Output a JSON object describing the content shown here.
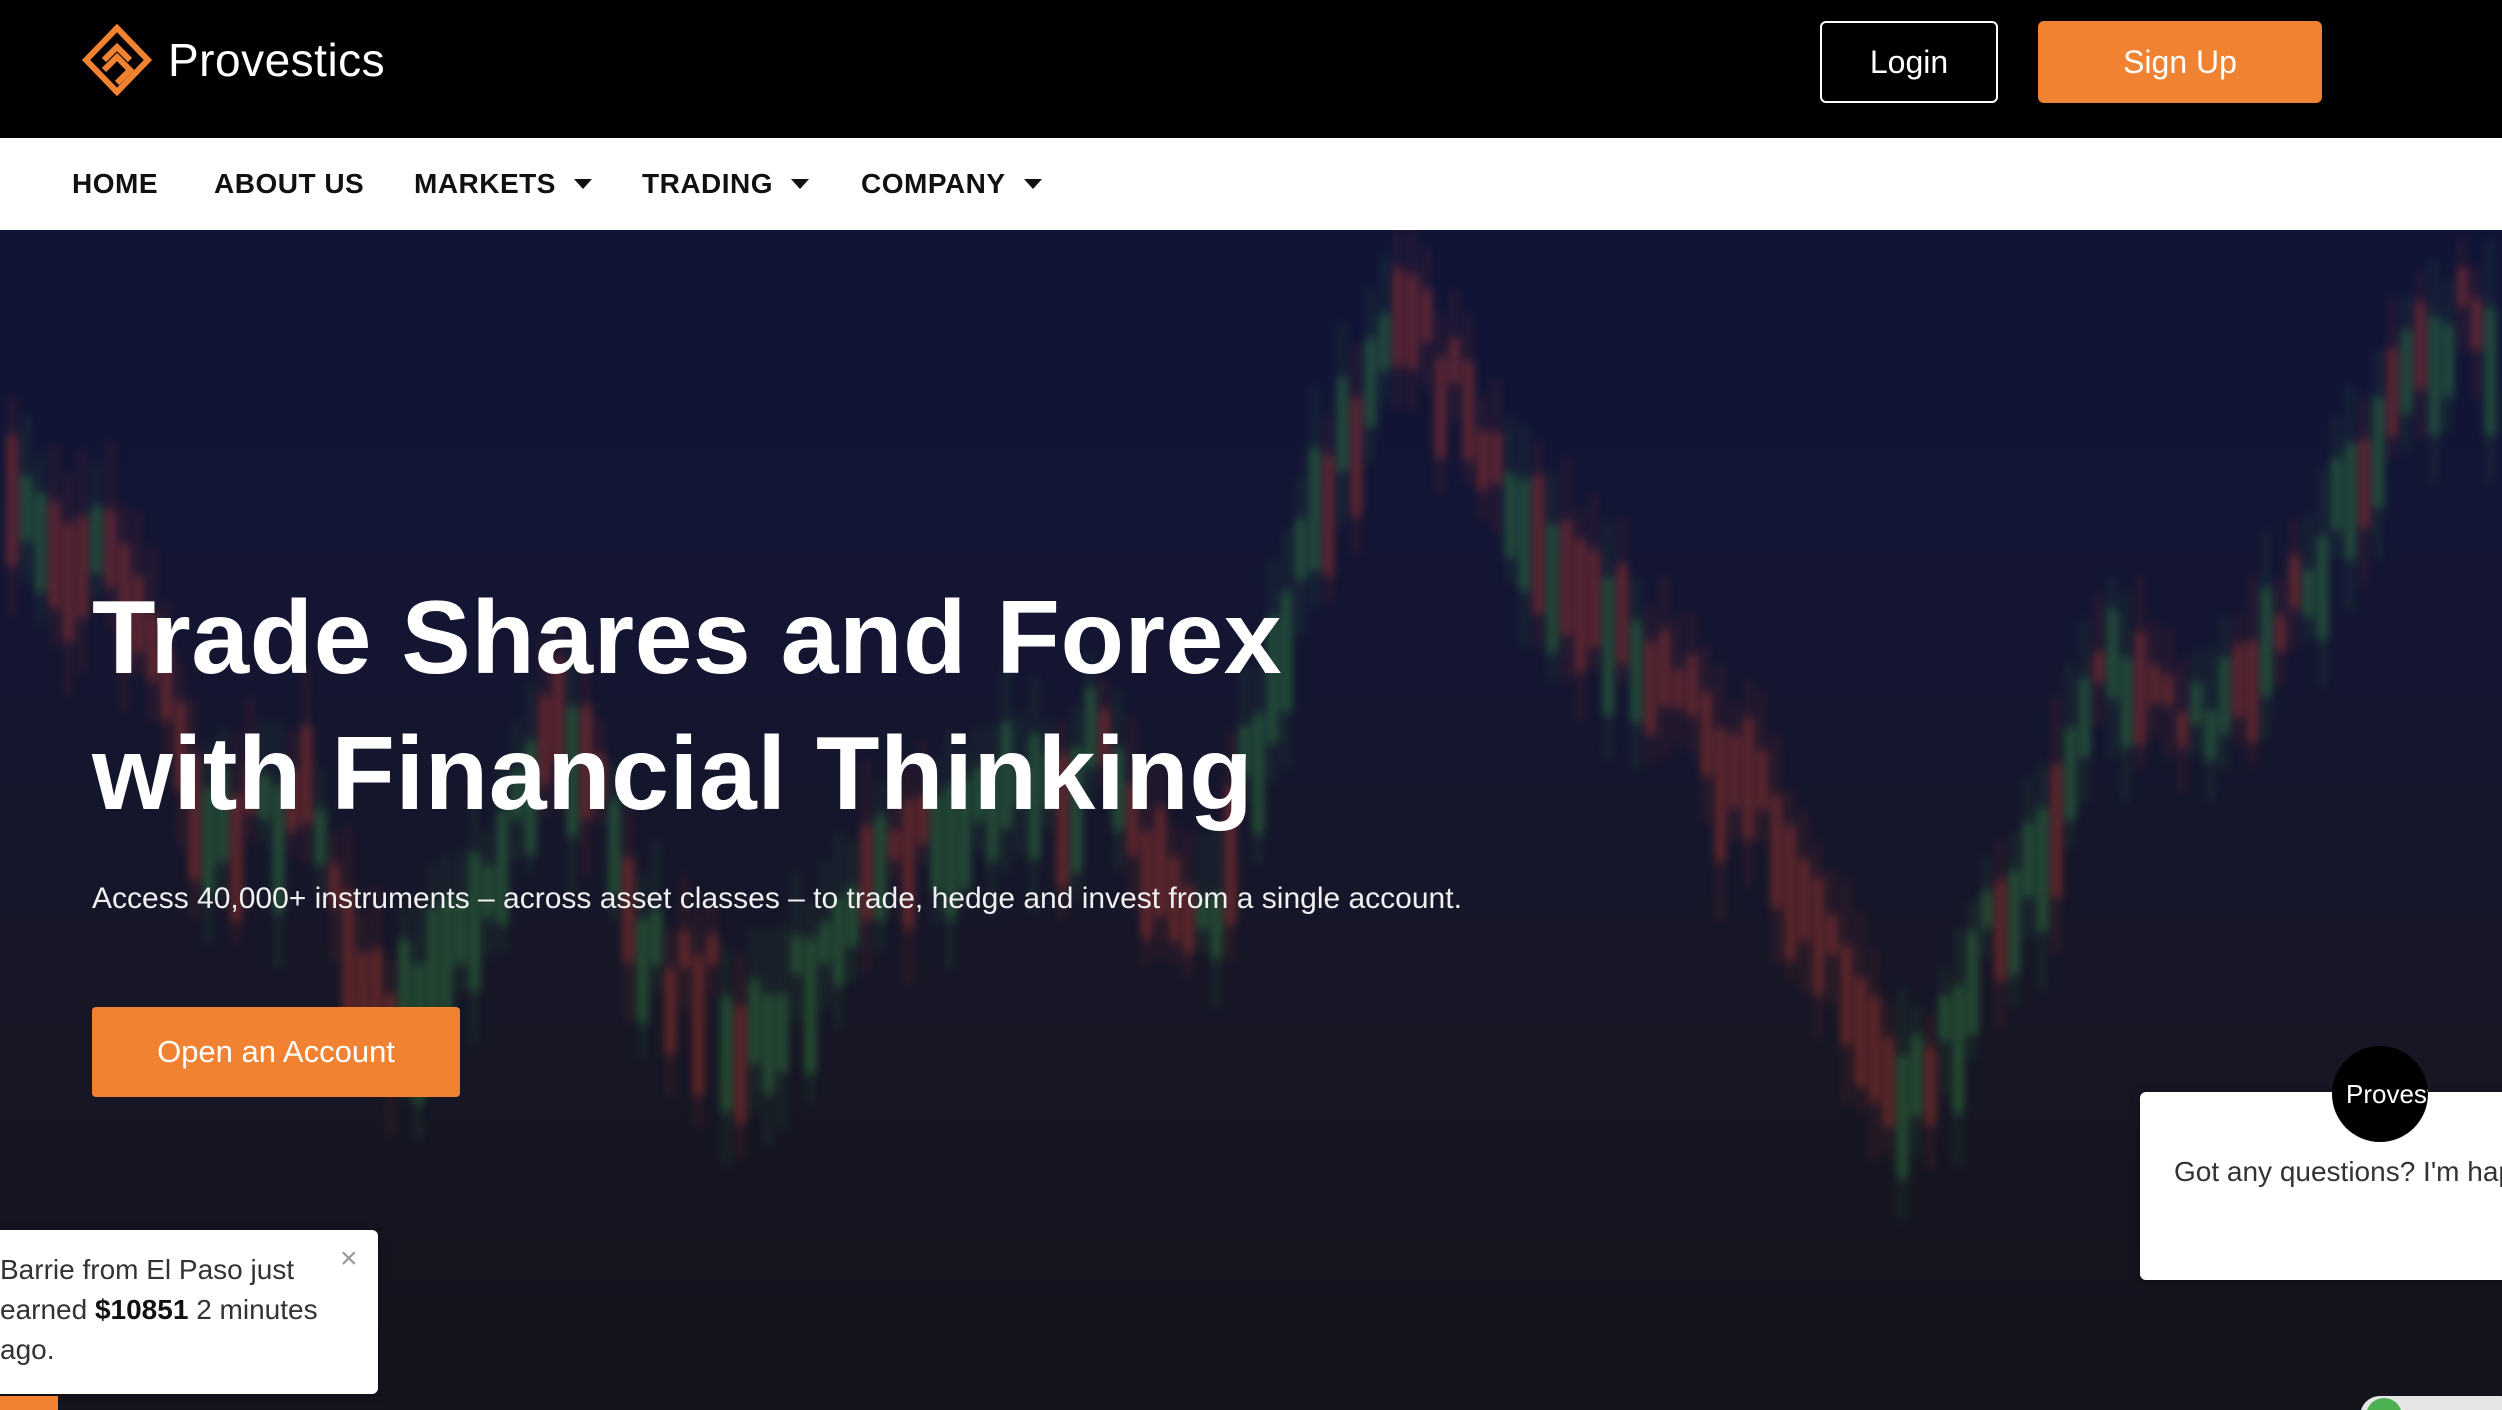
{
  "header": {
    "brand": "Provestics",
    "login_label": "Login",
    "signup_label": "Sign Up"
  },
  "nav": {
    "items": [
      {
        "label": "HOME",
        "dropdown": false
      },
      {
        "label": "ABOUT US",
        "dropdown": false
      },
      {
        "label": "MARKETS",
        "dropdown": true
      },
      {
        "label": "TRADING",
        "dropdown": true
      },
      {
        "label": "COMPANY",
        "dropdown": true
      }
    ]
  },
  "hero": {
    "title_line1": "Trade Shares and Forex",
    "title_line2": "with Financial Thinking",
    "subtitle": "Access 40,000+ instruments – across asset classes – to trade, hedge and invest from a single account.",
    "cta_label": "Open an Account"
  },
  "notification": {
    "text_before": "Barrie from El Paso just earned",
    "amount": "$10851",
    "text_after": "2 minutes ago.",
    "close_glyph": "×"
  },
  "chat": {
    "avatar_label": "Provestics",
    "message": "Got any questions? I'm happy to help."
  },
  "colors": {
    "accent": "#f08232",
    "topbar": "#000000",
    "nav_bg": "#ffffff",
    "hero_bg": "#131533",
    "candle_up": "#3fae4a",
    "candle_down": "#e8452f"
  }
}
